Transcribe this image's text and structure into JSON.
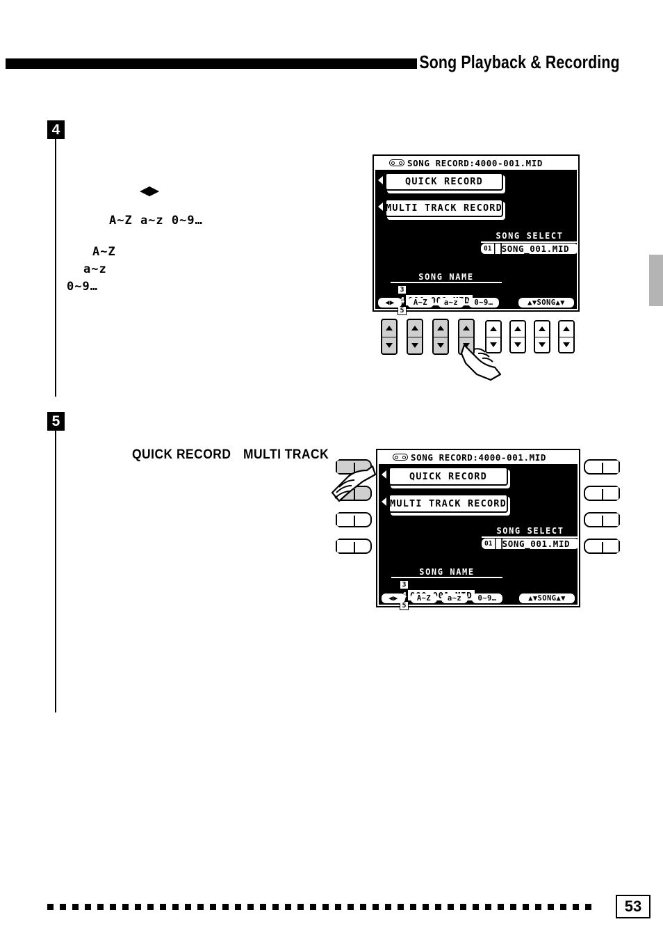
{
  "header": {
    "title": "Song Playback & Recording"
  },
  "footer": {
    "page_number": "53"
  },
  "steps": [
    {
      "marker": "4",
      "terms": {
        "cursor_arrows": "◀▶",
        "charset_row": "A~Z a~z   0~9…",
        "upper": "A~Z",
        "lower": "a~z",
        "digits": "0~9…"
      }
    },
    {
      "marker": "5",
      "terms": {
        "quick_record": "QUICK RECORD",
        "multi_track": "MULTI TRACK"
      }
    }
  ],
  "lcd": {
    "title": "SONG RECORD:4000-001.MID",
    "tape_icon": "cassette-tape-icon",
    "buttons": {
      "quick_record": "QUICK RECORD",
      "multi_track_record": "MULTI TRACK RECORD"
    },
    "song_select": {
      "label": "SONG SELECT",
      "index": "01",
      "value": "SONG_001.MID",
      "cursor_char": "█"
    },
    "song_name": {
      "label": "SONG NAME",
      "value": "000-001.MID",
      "cursor_char": "4",
      "char_above": "3",
      "char_below": "5"
    },
    "function_row": [
      {
        "name": "cursor-lr",
        "label": "◀▶"
      },
      {
        "name": "upper-case",
        "label": "A~Z"
      },
      {
        "name": "lower-case",
        "label": "a~z"
      },
      {
        "name": "digits",
        "label": "0~9…"
      }
    ],
    "song_nav_label": "▲▼SONG▲▼"
  },
  "colors": {
    "ink": "#000000",
    "paper": "#ffffff",
    "button_shaded": "#cfcfcf",
    "margin_tab": "#b4b4b4"
  }
}
